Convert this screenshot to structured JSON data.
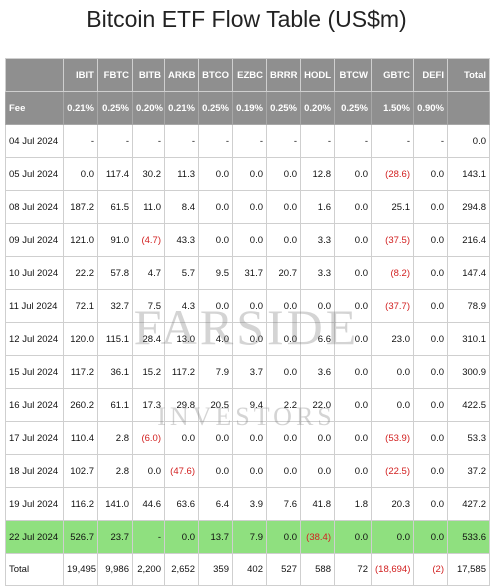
{
  "title": "Bitcoin ETF Flow Table (US$m)",
  "columns": [
    "",
    "IBIT",
    "FBTC",
    "BITB",
    "ARKB",
    "BTCO",
    "EZBC",
    "BRRR",
    "HODL",
    "BTCW",
    "GBTC",
    "DEFI",
    "Total"
  ],
  "fee_row": [
    "Fee",
    "0.21%",
    "0.25%",
    "0.20%",
    "0.21%",
    "0.25%",
    "0.19%",
    "0.25%",
    "0.20%",
    "0.25%",
    "1.50%",
    "0.90%",
    ""
  ],
  "rows": [
    [
      "04 Jul 2024",
      "-",
      "-",
      "-",
      "-",
      "-",
      "-",
      "-",
      "-",
      "-",
      "-",
      "-",
      "0.0"
    ],
    [
      "05 Jul 2024",
      "0.0",
      "117.4",
      "30.2",
      "11.3",
      "0.0",
      "0.0",
      "0.0",
      "12.8",
      "0.0",
      "(28.6)",
      "0.0",
      "143.1"
    ],
    [
      "08 Jul 2024",
      "187.2",
      "61.5",
      "11.0",
      "8.4",
      "0.0",
      "0.0",
      "0.0",
      "1.6",
      "0.0",
      "25.1",
      "0.0",
      "294.8"
    ],
    [
      "09 Jul 2024",
      "121.0",
      "91.0",
      "(4.7)",
      "43.3",
      "0.0",
      "0.0",
      "0.0",
      "3.3",
      "0.0",
      "(37.5)",
      "0.0",
      "216.4"
    ],
    [
      "10 Jul 2024",
      "22.2",
      "57.8",
      "4.7",
      "5.7",
      "9.5",
      "31.7",
      "20.7",
      "3.3",
      "0.0",
      "(8.2)",
      "0.0",
      "147.4"
    ],
    [
      "11 Jul 2024",
      "72.1",
      "32.7",
      "7.5",
      "4.3",
      "0.0",
      "0.0",
      "0.0",
      "0.0",
      "0.0",
      "(37.7)",
      "0.0",
      "78.9"
    ],
    [
      "12 Jul 2024",
      "120.0",
      "115.1",
      "28.4",
      "13.0",
      "4.0",
      "0.0",
      "0.0",
      "6.6",
      "0.0",
      "23.0",
      "0.0",
      "310.1"
    ],
    [
      "15 Jul 2024",
      "117.2",
      "36.1",
      "15.2",
      "117.2",
      "7.9",
      "3.7",
      "0.0",
      "3.6",
      "0.0",
      "0.0",
      "0.0",
      "300.9"
    ],
    [
      "16 Jul 2024",
      "260.2",
      "61.1",
      "17.3",
      "29.8",
      "20.5",
      "9.4",
      "2.2",
      "22.0",
      "0.0",
      "0.0",
      "0.0",
      "422.5"
    ],
    [
      "17 Jul 2024",
      "110.4",
      "2.8",
      "(6.0)",
      "0.0",
      "0.0",
      "0.0",
      "0.0",
      "0.0",
      "0.0",
      "(53.9)",
      "0.0",
      "53.3"
    ],
    [
      "18 Jul 2024",
      "102.7",
      "2.8",
      "0.0",
      "(47.6)",
      "0.0",
      "0.0",
      "0.0",
      "0.0",
      "0.0",
      "(22.5)",
      "0.0",
      "37.2"
    ],
    [
      "19 Jul 2024",
      "116.2",
      "141.0",
      "44.6",
      "63.6",
      "6.4",
      "3.9",
      "7.6",
      "41.8",
      "1.8",
      "20.3",
      "0.0",
      "427.2"
    ],
    [
      "22 Jul 2024",
      "526.7",
      "23.7",
      "-",
      "0.0",
      "13.7",
      "7.9",
      "0.0",
      "(38.4)",
      "0.0",
      "0.0",
      "0.0",
      "533.6"
    ]
  ],
  "highlight_row_index": 12,
  "total_row": [
    "Total",
    "19,495",
    "9,986",
    "2,200",
    "2,652",
    "359",
    "402",
    "527",
    "588",
    "72",
    "(18,694)",
    "(2)",
    "17,585"
  ],
  "watermark": {
    "line1": "FARSIDE",
    "line2": "INVESTORS"
  },
  "colors": {
    "header_bg": "#8f8f8f",
    "highlight_bg": "#8fe07f",
    "negative": "#d22020"
  }
}
